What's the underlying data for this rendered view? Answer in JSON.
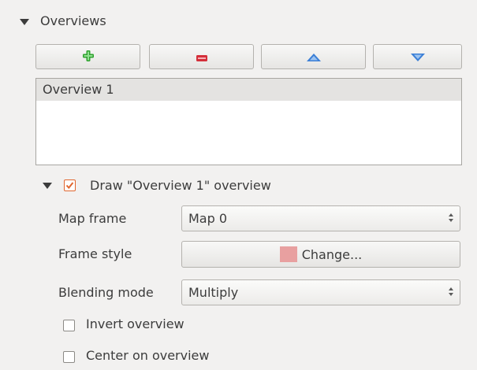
{
  "overviews_group": {
    "title": "Overviews",
    "toolbar": {
      "add_icon": "add-plus-icon",
      "remove_icon": "remove-minus-icon",
      "up_icon": "move-up-icon",
      "down_icon": "move-down-icon"
    },
    "list": {
      "items": [
        {
          "label": "Overview 1",
          "selected": true
        }
      ]
    }
  },
  "draw_overview": {
    "checked": true,
    "label": "Draw \"Overview 1\" overview",
    "fields": {
      "map_frame": {
        "label": "Map frame",
        "value": "Map 0"
      },
      "frame_style": {
        "label": "Frame style",
        "button_label": "Change...",
        "swatch_color": "#e8a0a0"
      },
      "blending_mode": {
        "label": "Blending mode",
        "value": "Multiply"
      }
    },
    "invert_overview": {
      "label": "Invert overview",
      "checked": false
    },
    "center_on_overview": {
      "label": "Center on overview",
      "checked": false
    }
  },
  "colors": {
    "checkbox_accent": "#e0662f",
    "add_icon": "#2fa22f",
    "remove_icon": "#d42f3a",
    "arrow_icon": "#3b7fd6"
  }
}
